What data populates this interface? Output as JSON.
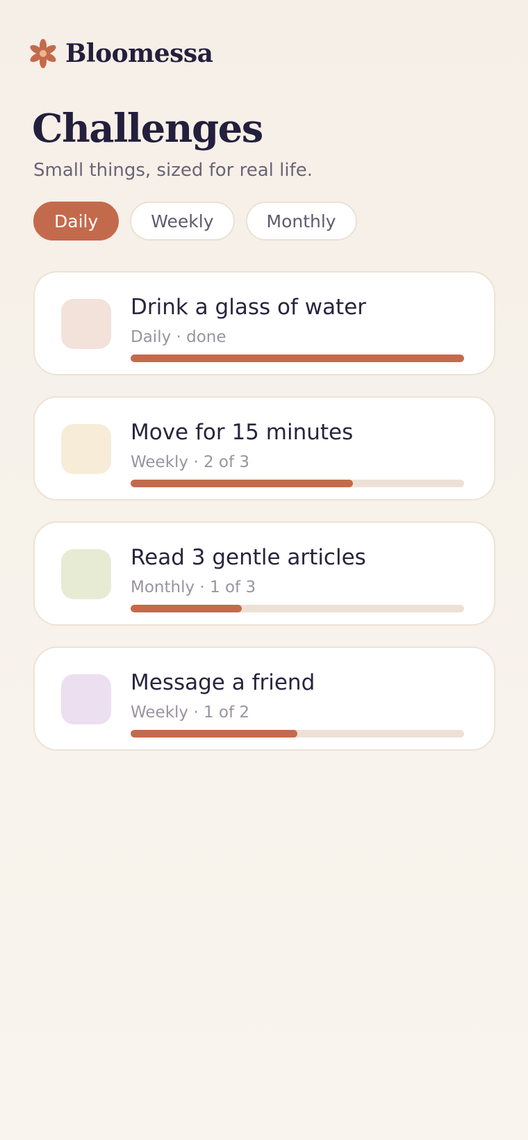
{
  "app": {
    "brand": "Bloomessa",
    "logo_icon": "flower-icon"
  },
  "colors": {
    "accent": "#c46a4c",
    "track": "#ede1d6",
    "ink": "#241f3c"
  },
  "page": {
    "title": "Challenges",
    "subtitle": "Small things, sized for real life."
  },
  "filters": [
    {
      "label": "Daily",
      "active": true
    },
    {
      "label": "Weekly",
      "active": false
    },
    {
      "label": "Monthly",
      "active": false
    }
  ],
  "challenges": [
    {
      "title": "Drink a glass of water",
      "meta": "Daily · done",
      "progress": 1.0,
      "thumb_color": "#f3e2da"
    },
    {
      "title": "Move for 15 minutes",
      "meta": "Weekly · 2 of 3",
      "progress": 0.667,
      "thumb_color": "#f6ecd8"
    },
    {
      "title": "Read 3 gentle articles",
      "meta": "Monthly · 1 of 3",
      "progress": 0.333,
      "thumb_color": "#e8ebd4"
    },
    {
      "title": "Message a friend",
      "meta": "Weekly · 1 of 2",
      "progress": 0.5,
      "thumb_color": "#ecdff0"
    }
  ]
}
